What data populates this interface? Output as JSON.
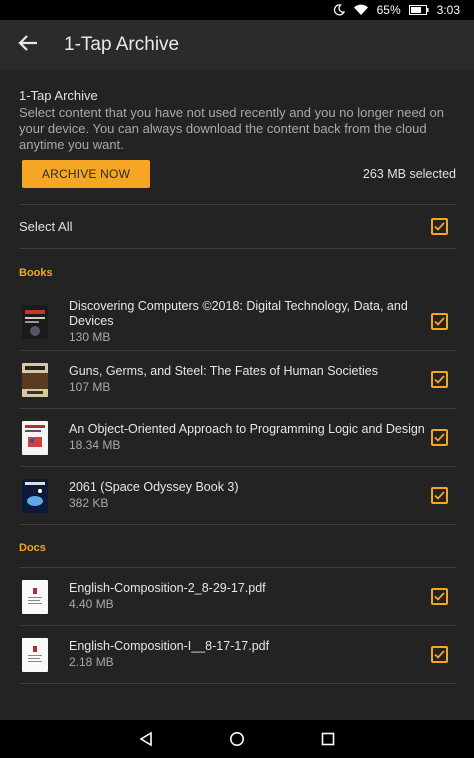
{
  "status": {
    "battery_percent": "65%",
    "time": "3:03"
  },
  "header": {
    "title": "1-Tap Archive"
  },
  "intro": {
    "title": "1-Tap Archive",
    "description": "Select content that you have not used recently and you no longer need on your device. You can always download the content back from the cloud anytime you want."
  },
  "archive": {
    "button_label": "ARCHIVE NOW",
    "selected_size": "263 MB selected"
  },
  "select_all": {
    "label": "Select All",
    "checked": true
  },
  "sections": {
    "books": {
      "label": "Books",
      "items": [
        {
          "title": "Discovering Computers ©2018: Digital Technology, Data, and Devices",
          "size": "130 MB",
          "checked": true
        },
        {
          "title": "Guns, Germs, and Steel: The Fates of Human Societies",
          "size": "107 MB",
          "checked": true
        },
        {
          "title": "An Object-Oriented Approach to Programming Logic and Design",
          "size": "18.34 MB",
          "checked": true
        },
        {
          "title": "2061 (Space Odyssey Book 3)",
          "size": "382 KB",
          "checked": true
        }
      ]
    },
    "docs": {
      "label": "Docs",
      "items": [
        {
          "title": "English-Composition-2_8-29-17.pdf",
          "size": "4.40 MB",
          "checked": true
        },
        {
          "title": "English-Composition-I__8-17-17.pdf",
          "size": "2.18 MB",
          "checked": true
        }
      ]
    }
  },
  "colors": {
    "accent": "#f5a623",
    "background": "#232323",
    "appbar": "#2b2b2b"
  },
  "icons": [
    "moon-icon",
    "wifi-icon",
    "battery-icon",
    "back-arrow-icon",
    "checkbox-checked-icon",
    "nav-back-icon",
    "nav-home-icon",
    "nav-recents-icon"
  ]
}
